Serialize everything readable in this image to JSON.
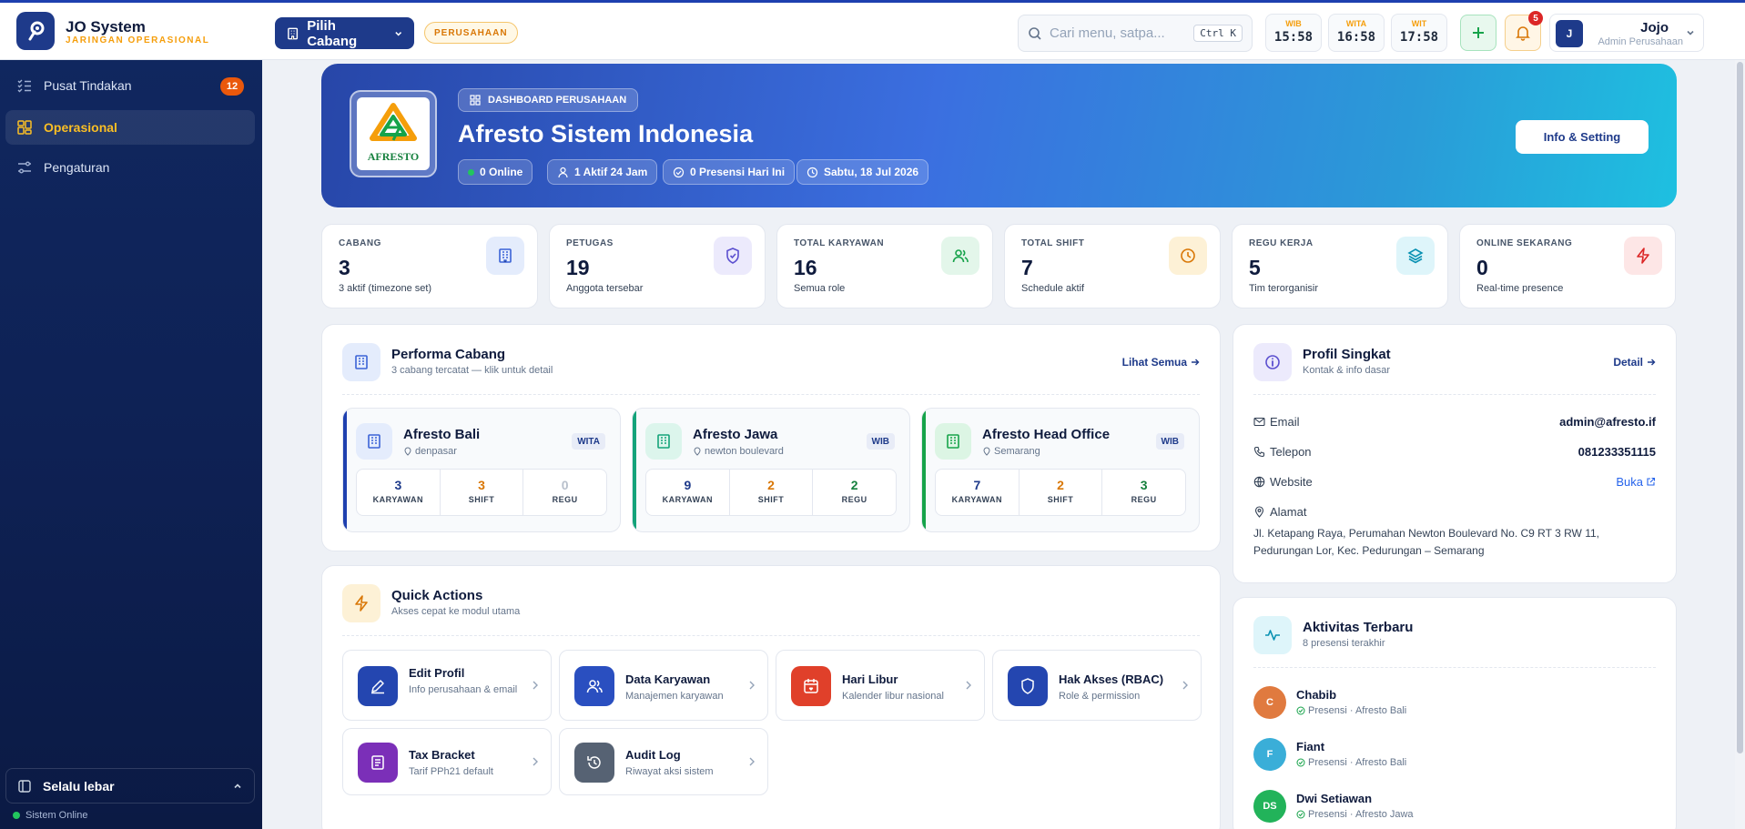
{
  "app": {
    "name": "JO System",
    "tagline": "JARINGAN OPERASIONAL"
  },
  "header": {
    "branch_button": "Pilih Cabang",
    "scope_badge": "PERUSAHAAN",
    "search_placeholder": "Cari menu, satpa...",
    "search_shortcut": "Ctrl K",
    "clocks": [
      {
        "zone": "WIB",
        "time": "15:58"
      },
      {
        "zone": "WITA",
        "time": "16:58"
      },
      {
        "zone": "WIT",
        "time": "17:58"
      }
    ],
    "notification_count": "5",
    "user": {
      "initial": "J",
      "name": "Jojo",
      "role": "Admin Perusahaan"
    }
  },
  "sidebar": {
    "items": [
      {
        "label": "Pusat Tindakan",
        "badge": "12",
        "icon": "checklist-icon"
      },
      {
        "label": "Operasional",
        "icon": "grid-icon",
        "active": true
      },
      {
        "label": "Pengaturan",
        "icon": "sliders-icon"
      }
    ],
    "footer_toggle": "Selalu lebar",
    "status": "Sistem Online"
  },
  "hero": {
    "tag": "DASHBOARD PERUSAHAAN",
    "logo_text": "AFRESTO",
    "title": "Afresto Sistem Indonesia",
    "pills": [
      "0 Online",
      "1 Aktif 24 Jam",
      "0 Presensi Hari Ini",
      "Sabtu, 18 Jul 2026"
    ],
    "settings_button": "Info & Setting"
  },
  "stats": [
    {
      "label": "CABANG",
      "value": "3",
      "sub": "3 aktif (timezone set)",
      "icon": "building-icon",
      "color": "#3b63d6"
    },
    {
      "label": "PETUGAS",
      "value": "19",
      "sub": "Anggota tersebar",
      "icon": "shield-icon",
      "color": "#5b4fcf"
    },
    {
      "label": "TOTAL KARYAWAN",
      "value": "16",
      "sub": "Semua role",
      "icon": "users-icon",
      "color": "#16a34a"
    },
    {
      "label": "TOTAL SHIFT",
      "value": "7",
      "sub": "Schedule aktif",
      "icon": "clock-icon",
      "color": "#d97706"
    },
    {
      "label": "REGU KERJA",
      "value": "5",
      "sub": "Tim terorganisir",
      "icon": "layers-icon",
      "color": "#0891b2"
    },
    {
      "label": "ONLINE SEKARANG",
      "value": "0",
      "sub": "Real-time presence",
      "icon": "bolt-icon",
      "color": "#dc2626"
    }
  ],
  "performance": {
    "title": "Performa Cabang",
    "subtitle": "3 cabang tercatat — klik untuk detail",
    "link": "Lihat Semua",
    "branches": [
      {
        "name": "Afresto Bali",
        "location": "denpasar",
        "tz": "WITA",
        "karyawan": "3",
        "shift": "3",
        "regu": "0"
      },
      {
        "name": "Afresto Jawa",
        "location": "newton boulevard",
        "tz": "WIB",
        "karyawan": "9",
        "shift": "2",
        "regu": "2"
      },
      {
        "name": "Afresto Head Office",
        "location": "Semarang",
        "tz": "WIB",
        "karyawan": "7",
        "shift": "2",
        "regu": "3"
      }
    ],
    "metric_labels": {
      "karyawan": "KARYAWAN",
      "shift": "SHIFT",
      "regu": "REGU"
    }
  },
  "quick_actions": {
    "title": "Quick Actions",
    "subtitle": "Akses cepat ke modul utama",
    "items": [
      {
        "title": "Edit Profil",
        "sub": "Info perusahaan & email",
        "icon": "pencil-icon"
      },
      {
        "title": "Data Karyawan",
        "sub": "Manajemen karyawan",
        "icon": "users-icon"
      },
      {
        "title": "Hari Libur",
        "sub": "Kalender libur nasional",
        "icon": "calendar-icon"
      },
      {
        "title": "Hak Akses (RBAC)",
        "sub": "Role & permission",
        "icon": "shield-icon"
      },
      {
        "title": "Tax Bracket",
        "sub": "Tarif PPh21 default",
        "icon": "receipt-icon"
      },
      {
        "title": "Audit Log",
        "sub": "Riwayat aksi sistem",
        "icon": "history-icon"
      }
    ]
  },
  "profile": {
    "title": "Profil Singkat",
    "subtitle": "Kontak & info dasar",
    "link": "Detail",
    "email_label": "Email",
    "email": "admin@afresto.if",
    "phone_label": "Telepon",
    "phone": "081233351115",
    "website_label": "Website",
    "website": "Buka",
    "address_label": "Alamat",
    "address": "Jl. Ketapang Raya, Perumahan Newton Boulevard No. C9 RT 3 RW 11, Pedurungan Lor, Kec. Pedurungan – Semarang"
  },
  "activity": {
    "title": "Aktivitas Terbaru",
    "subtitle": "8 presensi terakhir",
    "items": [
      {
        "initial": "C",
        "name": "Chabib",
        "desc": "Presensi · Afresto Bali",
        "color": "#e07a3f"
      },
      {
        "initial": "F",
        "name": "Fiant",
        "desc": "Presensi · Afresto Bali",
        "color": "#3aaed8"
      },
      {
        "initial": "DS",
        "name": "Dwi Setiawan",
        "desc": "Presensi · Afresto Jawa",
        "color": "#22b35a"
      }
    ]
  }
}
